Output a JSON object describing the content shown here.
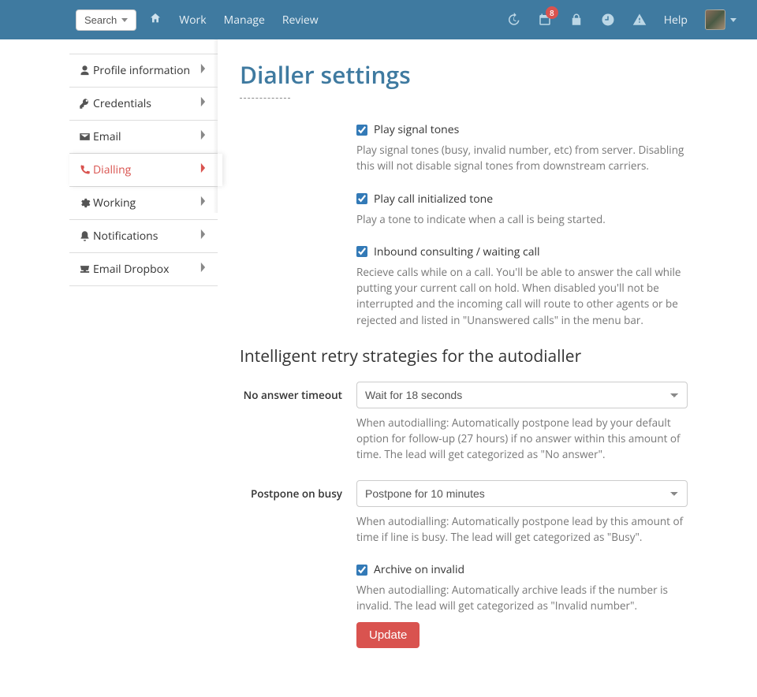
{
  "topbar": {
    "search_label": "Search",
    "nav": {
      "work": "Work",
      "manage": "Manage",
      "review": "Review"
    },
    "calendar_badge": "8",
    "help": "Help"
  },
  "sidebar": {
    "items": [
      {
        "label": "Profile information"
      },
      {
        "label": "Credentials"
      },
      {
        "label": "Email"
      },
      {
        "label": "Dialling"
      },
      {
        "label": "Working"
      },
      {
        "label": "Notifications"
      },
      {
        "label": "Email Dropbox"
      }
    ]
  },
  "main": {
    "title": "Dialler settings",
    "signal_tones": {
      "label": "Play signal tones",
      "help": "Play signal tones (busy, invalid number, etc) from server. Disabling this will not disable signal tones from downstream carriers."
    },
    "call_initialized": {
      "label": "Play call initialized tone",
      "help": "Play a tone to indicate when a call is being started."
    },
    "inbound": {
      "label": "Inbound consulting / waiting call",
      "help": "Recieve calls while on a call. You'll be able to answer the call while putting your current call on hold. When disabled you'll not be interrupted and the incoming call will route to other agents or be rejected and listed in \"Unanswered calls\" in the menu bar."
    },
    "retry_title": "Intelligent retry strategies for the autodialler",
    "no_answer": {
      "label": "No answer timeout",
      "selected": "Wait for 18 seconds",
      "help": "When autodialling: Automatically postpone lead by your default option for follow-up (27 hours) if no answer within this amount of time. The lead will get categorized as \"No answer\"."
    },
    "postpone_busy": {
      "label": "Postpone on busy",
      "selected": "Postpone for 10 minutes",
      "help": "When autodialling: Automatically postpone lead by this amount of time if line is busy. The lead will get categorized as \"Busy\"."
    },
    "archive_invalid": {
      "label": "Archive on invalid",
      "help": "When autodialling: Automatically archive leads if the number is invalid. The lead will get categorized as \"Invalid number\"."
    },
    "update_btn": "Update"
  }
}
